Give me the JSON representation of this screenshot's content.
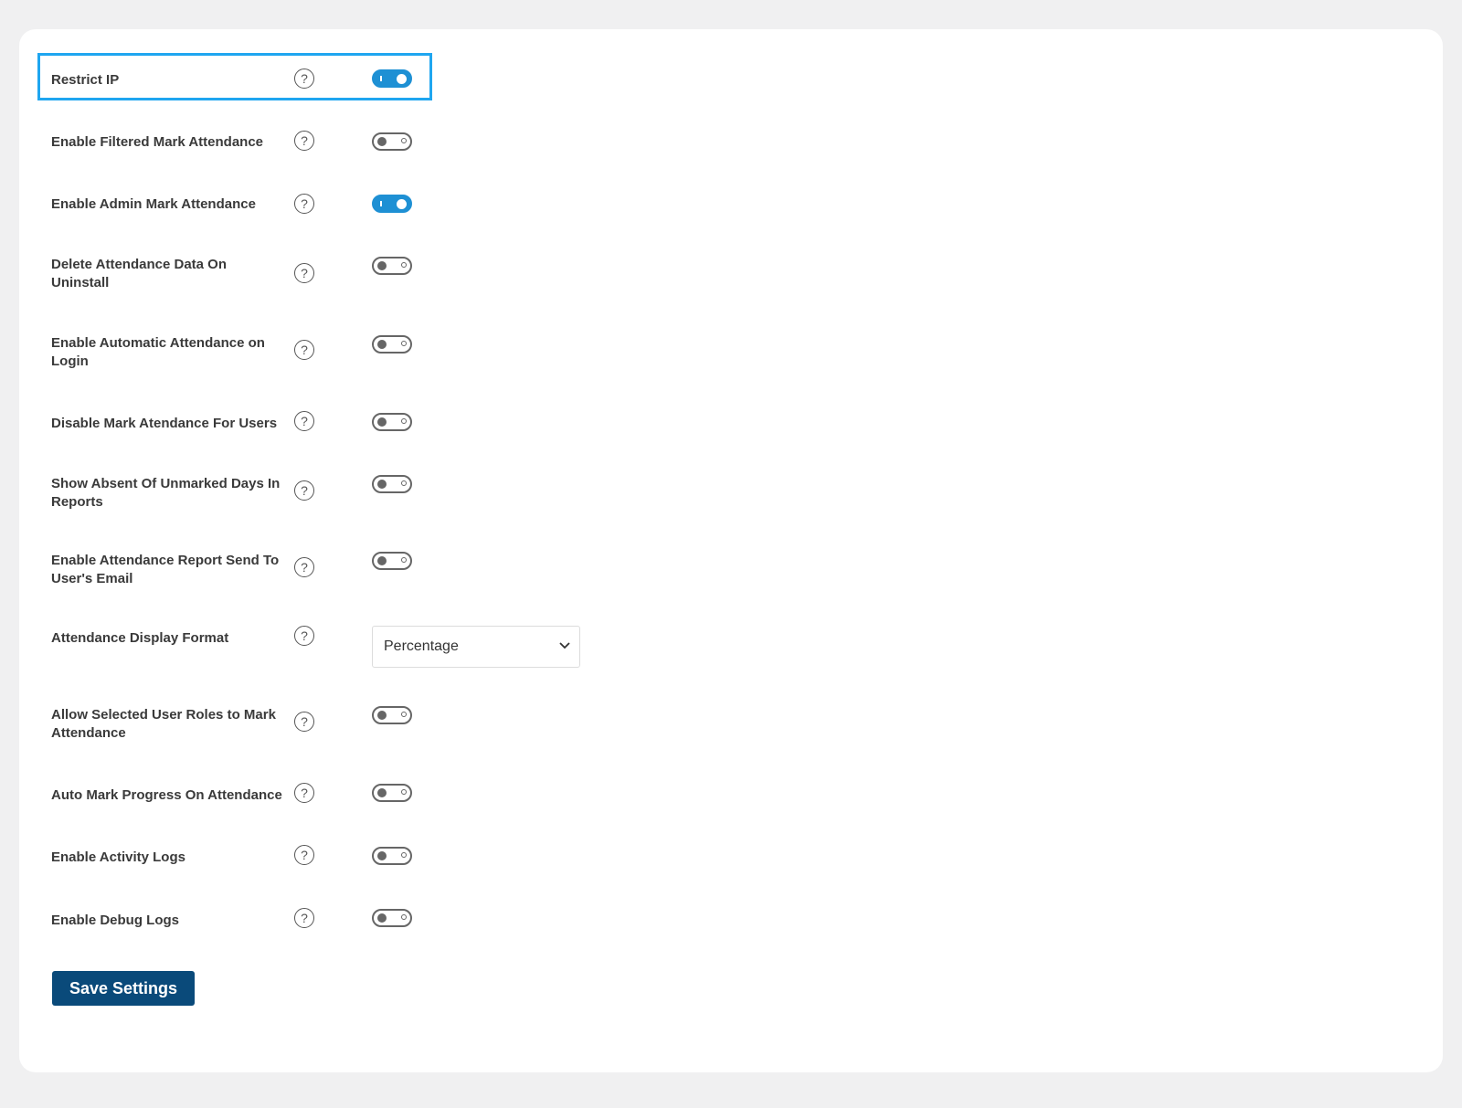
{
  "settings": [
    {
      "label": "Restrict IP",
      "on": true,
      "help": "?"
    },
    {
      "label": "Enable Filtered Mark Attendance",
      "on": false,
      "help": "?"
    },
    {
      "label": "Enable Admin Mark Attendance",
      "on": true,
      "help": "?"
    },
    {
      "label": "Delete Attendance Data On Uninstall",
      "on": false,
      "help": "?"
    },
    {
      "label": "Enable Automatic Attendance on Login",
      "on": false,
      "help": "?"
    },
    {
      "label": "Disable Mark Atendance For Users",
      "on": false,
      "help": "?"
    },
    {
      "label": "Show Absent Of Unmarked Days In Reports",
      "on": false,
      "help": "?"
    },
    {
      "label": "Enable Attendance Report Send To User's Email",
      "on": false,
      "help": "?"
    },
    {
      "label": "Attendance Display Format",
      "help": "?"
    },
    {
      "label": "Allow Selected User Roles to Mark Attendance",
      "on": false,
      "help": "?"
    },
    {
      "label": "Auto Mark Progress On Attendance",
      "on": false,
      "help": "?"
    },
    {
      "label": "Enable Activity Logs",
      "on": false,
      "help": "?"
    },
    {
      "label": "Enable Debug Logs",
      "on": false,
      "help": "?"
    }
  ],
  "display_format": {
    "selected": "Percentage"
  },
  "save_button": {
    "label": "Save Settings"
  },
  "colors": {
    "accent": "#1e90d4",
    "highlight": "#1fa6f0",
    "button": "#0a4a7a"
  }
}
